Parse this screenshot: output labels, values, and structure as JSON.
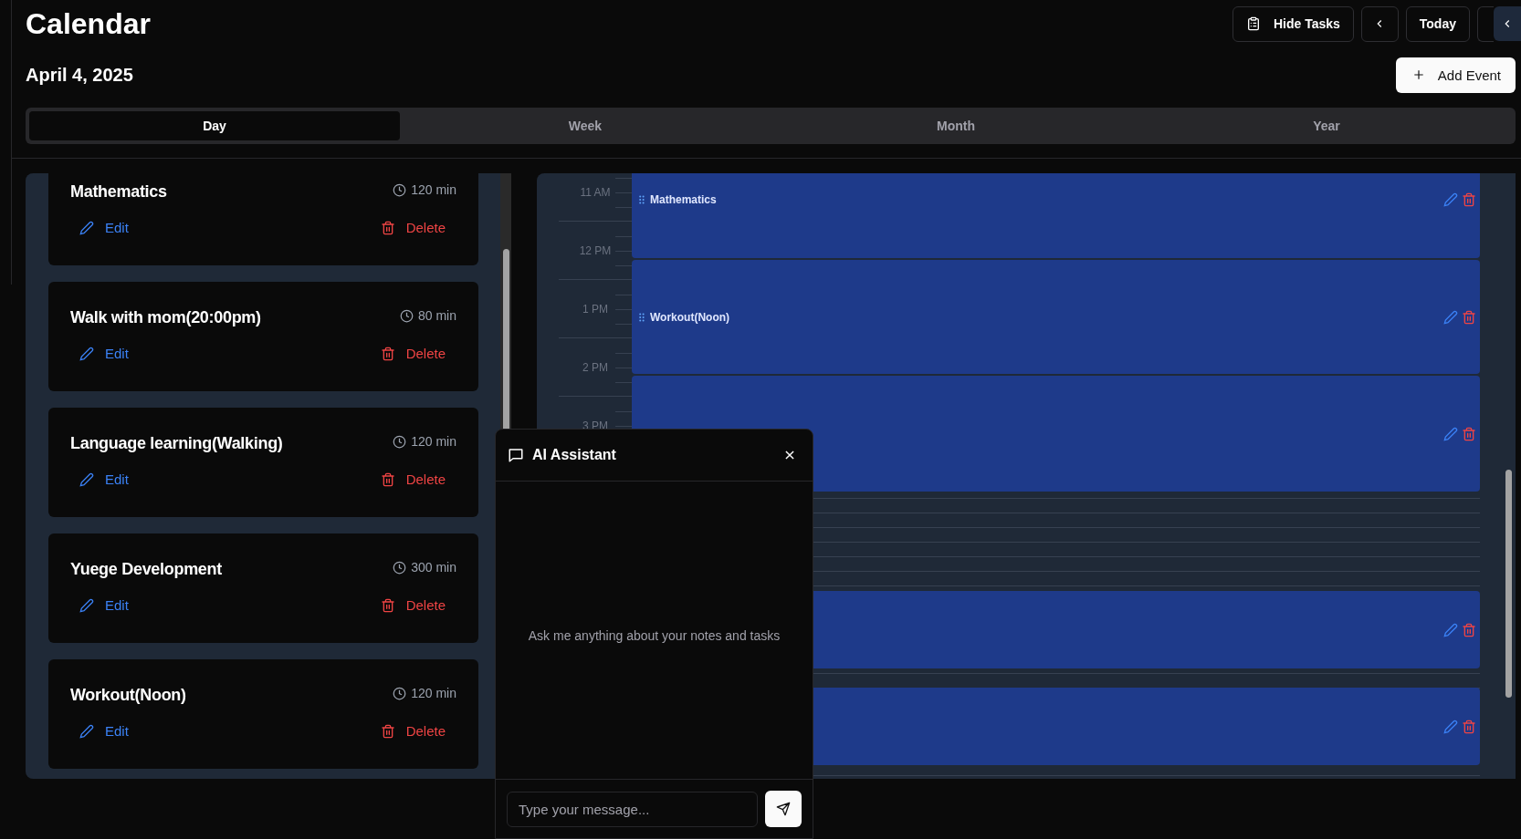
{
  "header": {
    "title": "Calendar",
    "date": "April 4, 2025"
  },
  "toolbar": {
    "hide_tasks": "Hide Tasks",
    "today": "Today",
    "add_event": "Add Event"
  },
  "view_tabs": [
    {
      "label": "Day",
      "selected": true
    },
    {
      "label": "Week",
      "selected": false
    },
    {
      "label": "Month",
      "selected": false
    },
    {
      "label": "Year",
      "selected": false
    }
  ],
  "tasks": [
    {
      "title": "Mathematics",
      "duration": "120 min",
      "edit": "Edit",
      "delete": "Delete"
    },
    {
      "title": "Walk with mom(20:00pm)",
      "duration": "80 min",
      "edit": "Edit",
      "delete": "Delete"
    },
    {
      "title": "Language learning(Walking)",
      "duration": "120 min",
      "edit": "Edit",
      "delete": "Delete"
    },
    {
      "title": "Yuege Development",
      "duration": "300 min",
      "edit": "Edit",
      "delete": "Delete"
    },
    {
      "title": "Workout(Noon)",
      "duration": "120 min",
      "edit": "Edit",
      "delete": "Delete"
    }
  ],
  "day_view": {
    "hours": [
      "11 AM",
      "12 PM",
      "1 PM",
      "2 PM",
      "3 PM"
    ],
    "events": [
      {
        "kind": "event",
        "title": "Mathematics"
      },
      {
        "kind": "event",
        "title": "Workout(Noon)"
      },
      {
        "kind": "event"
      },
      {
        "kind": "event"
      },
      {
        "kind": "event"
      }
    ]
  },
  "assistant": {
    "title": "AI Assistant",
    "empty_message": "Ask me anything about your notes and tasks",
    "input": {
      "placeholder": "Type your message..."
    }
  }
}
